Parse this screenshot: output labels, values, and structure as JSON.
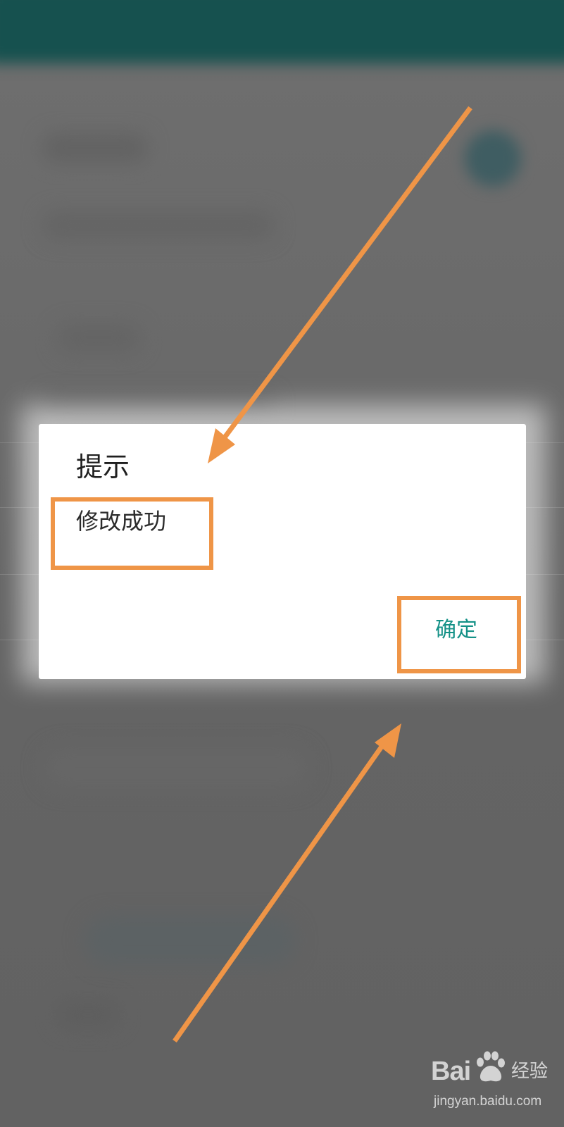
{
  "dialog": {
    "title": "提示",
    "message": "修改成功",
    "confirm_label": "确定"
  },
  "watermark": {
    "logo_text": "Bai",
    "logo_suffix": "经验",
    "url": "jingyan.baidu.com"
  },
  "colors": {
    "app_bar": "#16514f",
    "accent_button_text": "#149187",
    "annotation_orange": "#ef9547",
    "scrim": "#5f5f5f"
  },
  "icons": [
    "baidu-paw-icon"
  ]
}
